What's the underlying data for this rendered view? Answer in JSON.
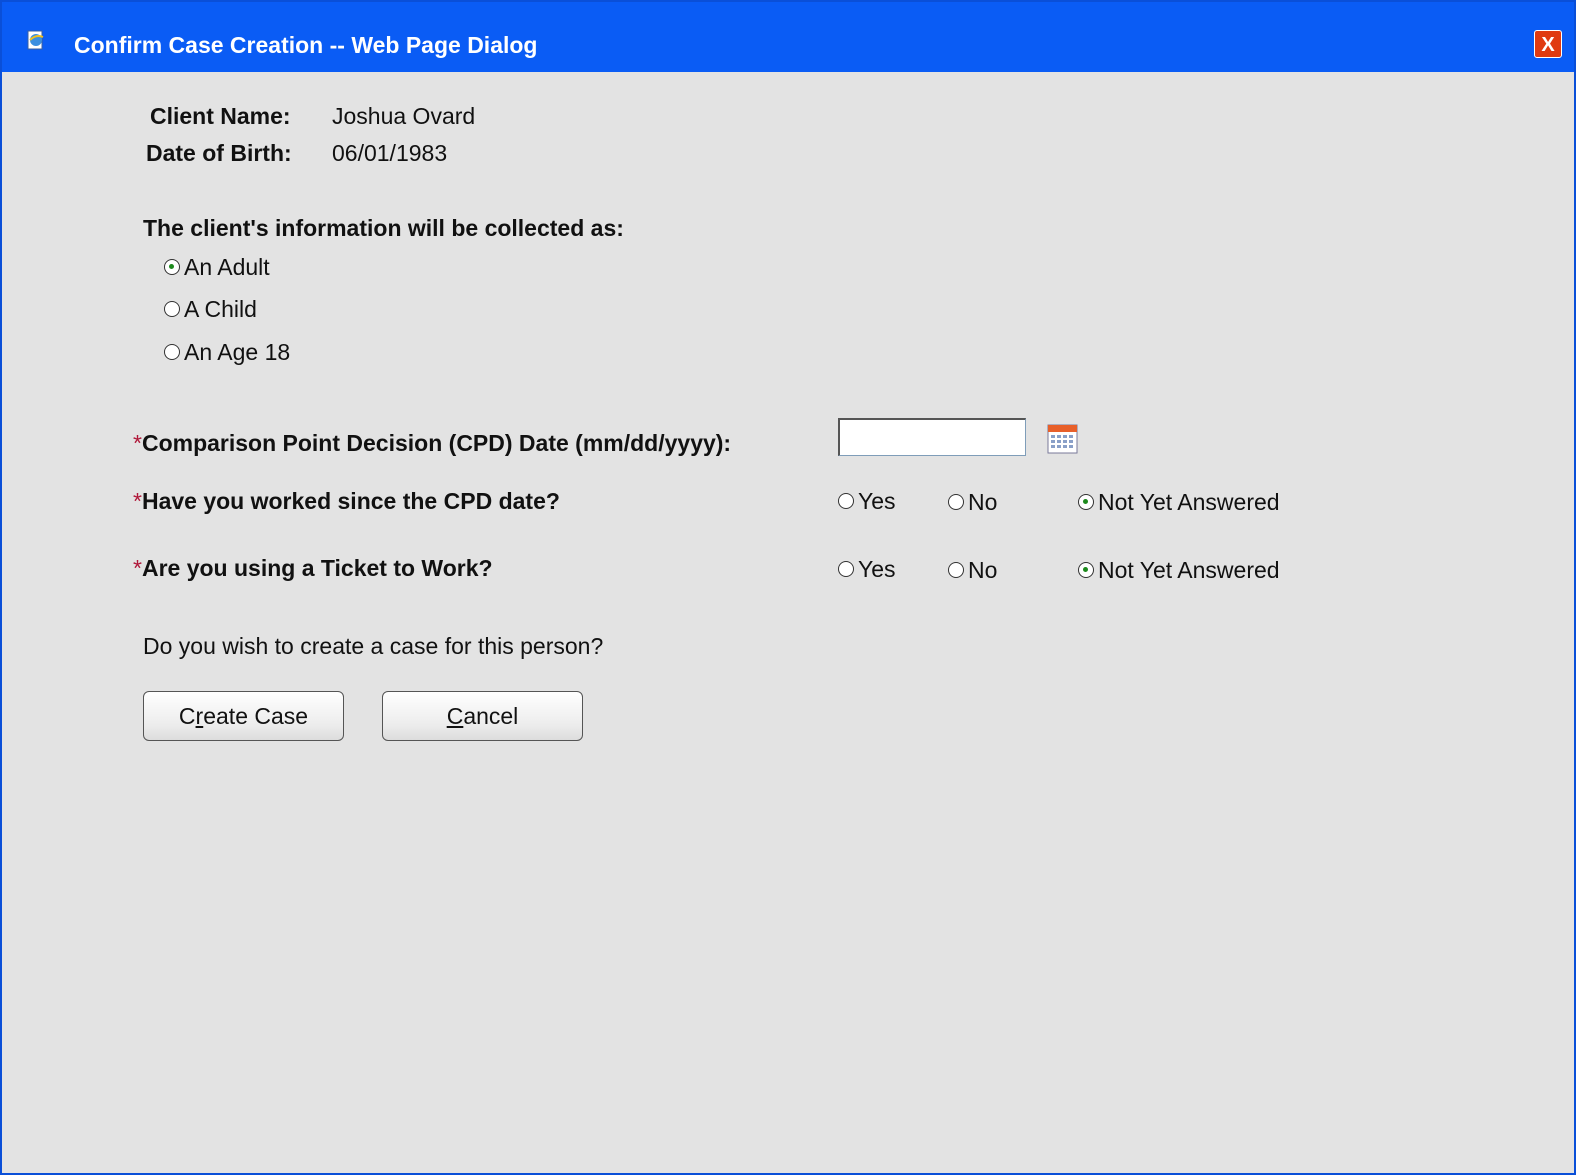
{
  "window": {
    "title": "Confirm Case Creation -- Web Page Dialog",
    "close_label": "X"
  },
  "client": {
    "name_label": "Client Name:",
    "name_value": "Joshua Ovard",
    "dob_label": "Date of Birth:",
    "dob_value": "06/01/1983"
  },
  "collection": {
    "heading": "The client's information will be collected as:",
    "options": [
      {
        "label": "An Adult",
        "checked": true
      },
      {
        "label": "A Child",
        "checked": false
      },
      {
        "label": "An Age 18",
        "checked": false
      }
    ]
  },
  "cpd": {
    "required_mark": "*",
    "label": "Comparison Point Decision (CPD) Date (mm/dd/yyyy):",
    "value": "",
    "calendar_icon": "calendar-icon"
  },
  "worked": {
    "required_mark": "*",
    "label": "Have you worked since the CPD date?",
    "options": [
      "Yes",
      "No",
      "Not Yet Answered"
    ],
    "selected": "Not Yet Answered"
  },
  "ticket": {
    "required_mark": "*",
    "label": "Are you using a Ticket to Work?",
    "options": [
      "Yes",
      "No",
      "Not Yet Answered"
    ],
    "selected": "Not Yet Answered"
  },
  "prompt": "Do you wish to create a case for this person?",
  "buttons": {
    "create_pre": "C",
    "create_access": "r",
    "create_post": "eate Case",
    "cancel_access": "C",
    "cancel_post": "ancel"
  },
  "colors": {
    "titlebar": "#0a5cf5",
    "background": "#e3e3e3",
    "required": "#b0183a",
    "close": "#e03a10"
  }
}
